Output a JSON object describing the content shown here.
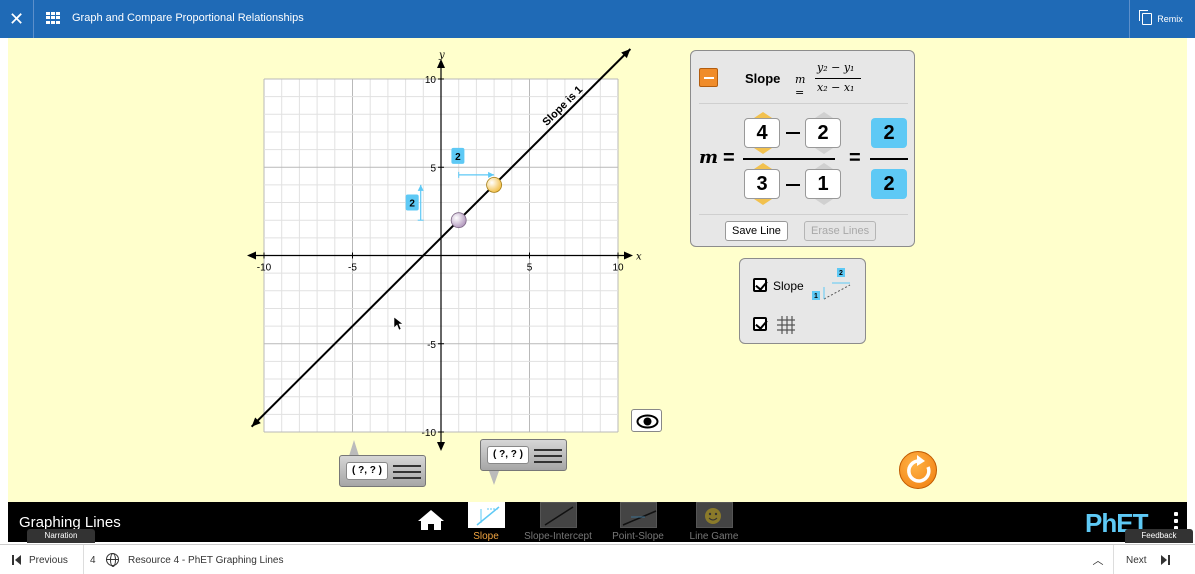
{
  "topbar": {
    "close_icon": "close-icon",
    "title": "Graph and Compare Proportional Relationships",
    "remix_label": "Remix"
  },
  "graph": {
    "x_axis_label": "x",
    "y_axis_label": "y",
    "x_range": [
      -10,
      10
    ],
    "y_range": [
      -10,
      10
    ],
    "x_tick_labels": [
      "-10",
      "-5",
      "5",
      "10"
    ],
    "y_tick_labels": [
      "10",
      "5",
      "-5",
      "-10"
    ],
    "line_label": "Slope is 1",
    "point1": [
      1,
      2
    ],
    "point2": [
      3,
      4
    ],
    "rise_label": "2",
    "run_label": "2",
    "colors": {
      "line": "#000000",
      "indicator": "#5ec9f5",
      "point1": "#b59cc0",
      "point2": "#f2c14e"
    }
  },
  "slope_panel": {
    "title": "Slope",
    "formula_m": "m =",
    "formula_num": "y₂ − y₁",
    "formula_den": "x₂ − x₁",
    "m_label": "m",
    "y2": "4",
    "y1": "2",
    "x2": "3",
    "x1": "1",
    "result_num": "2",
    "result_den": "2",
    "save_line": "Save Line",
    "erase_lines": "Erase Lines"
  },
  "options": {
    "slope_label": "Slope",
    "slope_checked": true,
    "grid_checked": true,
    "mini_rise": "2",
    "mini_run": "1"
  },
  "point_tools": [
    {
      "coords": "( ?, ? )"
    },
    {
      "coords": "( ?, ? )"
    }
  ],
  "navbar": {
    "sim_title": "Graphing Lines",
    "screens": [
      "Slope",
      "Slope-Intercept",
      "Point-Slope",
      "Line Game"
    ],
    "active_screen": "Slope",
    "logo": "PhET"
  },
  "tabs": {
    "narration": "Narration",
    "feedback": "Feedback"
  },
  "bottombar": {
    "previous": "Previous",
    "number": "4",
    "resource": "Resource 4 - PhET Graphing Lines",
    "next": "Next"
  }
}
